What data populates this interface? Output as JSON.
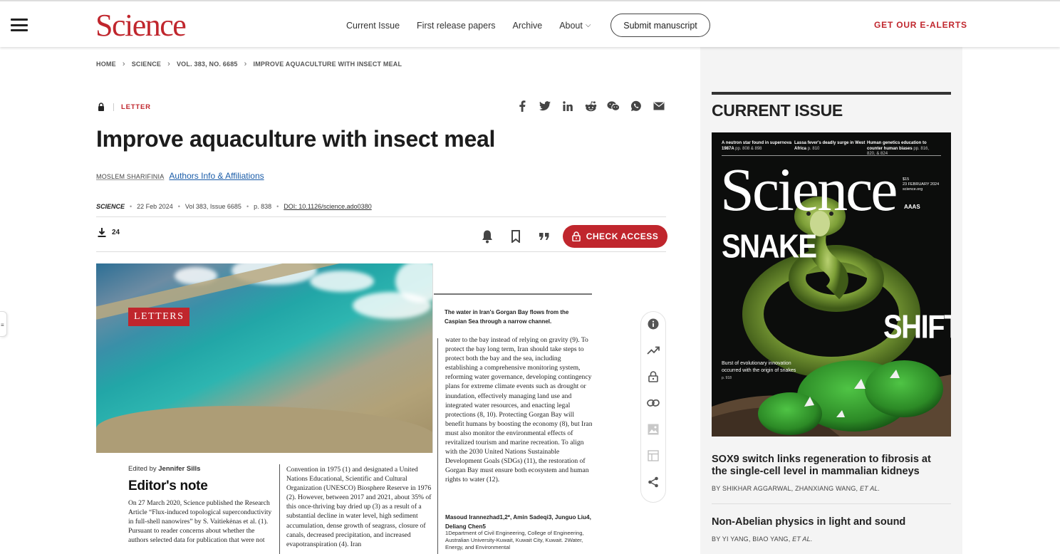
{
  "header": {
    "logo": "Science",
    "nav": [
      {
        "label": "Current Issue"
      },
      {
        "label": "First release papers"
      },
      {
        "label": "Archive"
      },
      {
        "label": "About"
      }
    ],
    "submit_label": "Submit manuscript",
    "ealerts_label": "GET OUR E-ALERTS"
  },
  "breadcrumb": [
    "HOME",
    "SCIENCE",
    "VOL. 383, NO. 6685",
    "IMPROVE AQUACULTURE WITH INSECT MEAL"
  ],
  "article": {
    "type": "LETTER",
    "title": "Improve aquaculture with insect meal",
    "author": "MOSLEM SHARIFINIA",
    "affiliations_link": "Authors Info & Affiliations",
    "journal": "SCIENCE",
    "date": "22 Feb 2024",
    "volume": "Vol 383, Issue 6685",
    "pages": "p. 838",
    "doi": "DOI: 10.1126/science.ado0380",
    "downloads": "24",
    "check_access_label": "CHECK ACCESS"
  },
  "share_icons": [
    "facebook-icon",
    "twitter-icon",
    "linkedin-icon",
    "reddit-icon",
    "wechat-icon",
    "whatsapp-icon",
    "email-icon"
  ],
  "toolbar_icons": [
    "bell-icon",
    "bookmark-icon",
    "quote-icon"
  ],
  "float_tools": [
    "info-icon",
    "metrics-icon",
    "lock-icon",
    "link-icon",
    "figures-icon",
    "tables-icon",
    "share-icon"
  ],
  "page_image": {
    "letters_label": "LETTERS",
    "caption": "The water in Iran's Gorgan Bay flows from the Caspian Sea through a narrow channel.",
    "col3_text": "water to the bay instead of relying on gravity (9). To protect the bay long term, Iran should take steps to protect both the bay and the sea, including establishing a comprehensive monitoring system, reforming water governance, developing contingency plans for extreme climate events such as drought or inundation, effectively managing land use and integrated water resources, and enacting legal protections (8, 10). Protecting Gorgan Bay will benefit humans by boosting the economy (8), but Iran must also monitor the environmental effects of revitalized tourism and marine recreation. To align with the 2030 United Nations Sustainable Development Goals (SDGs) (11), the restoration of Gorgan Bay must ensure both ecosystem and human rights to water (12).",
    "signoff": "Masoud Irannezhad1,2*, Amin Sadeqi3, Junguo Liu4, Deliang Chen5",
    "signoff_sub": "1Department of Civil Engineering, College of Engineering, Australian University-Kuwait, Kuwait City, Kuwait. 2Water, Energy, and Environmental",
    "edited_prefix": "Edited by",
    "edited_name": "Jennifer Sills",
    "editors_note_heading": "Editor's note",
    "col1_text": "On 27 March 2020, Science published the Research Article “Flux-induced topological superconductivity in full-shell nanowires” by S. Vaitiekėnas et al. (1). Pursuant to reader concerns about whether the authors selected data for publication that were not",
    "col2_text": "Convention in 1975 (1) and designated a United Nations Educational, Scientific and Cultural Organization (UNESCO) Biosphere Reserve in 1976 (2). However, between 2017 and 2021, about 35% of this once-thriving bay dried up (3) as a result of a substantial decline in water level, high sediment accumulation, dense growth of seagrass, closure of canals, decreased precipitation, and increased evapotranspiration (4). Iran"
  },
  "sidebar": {
    "heading": "CURRENT ISSUE",
    "cover": {
      "top_items": [
        {
          "text": "A neutron star found in supernova 1987A",
          "pages": "pp. 808 & 898"
        },
        {
          "text": "Lassa fever's deadly surge in West Africa",
          "pages": "p. 810"
        },
        {
          "text": "Human genetics education to counter human biases",
          "pages": "pp. 816, 820, & 824"
        }
      ],
      "logo": "Science",
      "price": "$15",
      "date": "23 FEBRUARY 2024",
      "site": "science.org",
      "aaas": "AAAS",
      "word1": "SNAKE",
      "word2": "SHIFT",
      "blurb": "Burst of evolutionary innovation occurred with the origin of snakes",
      "blurb_page": "p. 918"
    },
    "stories": [
      {
        "title": "SOX9 switch links regeneration to fibrosis at the single-cell level in mammalian kidneys",
        "authors": "BY SHIKHAR AGGARWAL, ZHANXIANG WANG,",
        "etal": "ET AL."
      },
      {
        "title": "Non-Abelian physics in light and sound",
        "authors": "BY YI YANG, BIAO YANG,",
        "etal": "ET AL."
      }
    ]
  },
  "colors": {
    "brand_red": "#c0262d",
    "link_blue": "#1a5ca8"
  }
}
